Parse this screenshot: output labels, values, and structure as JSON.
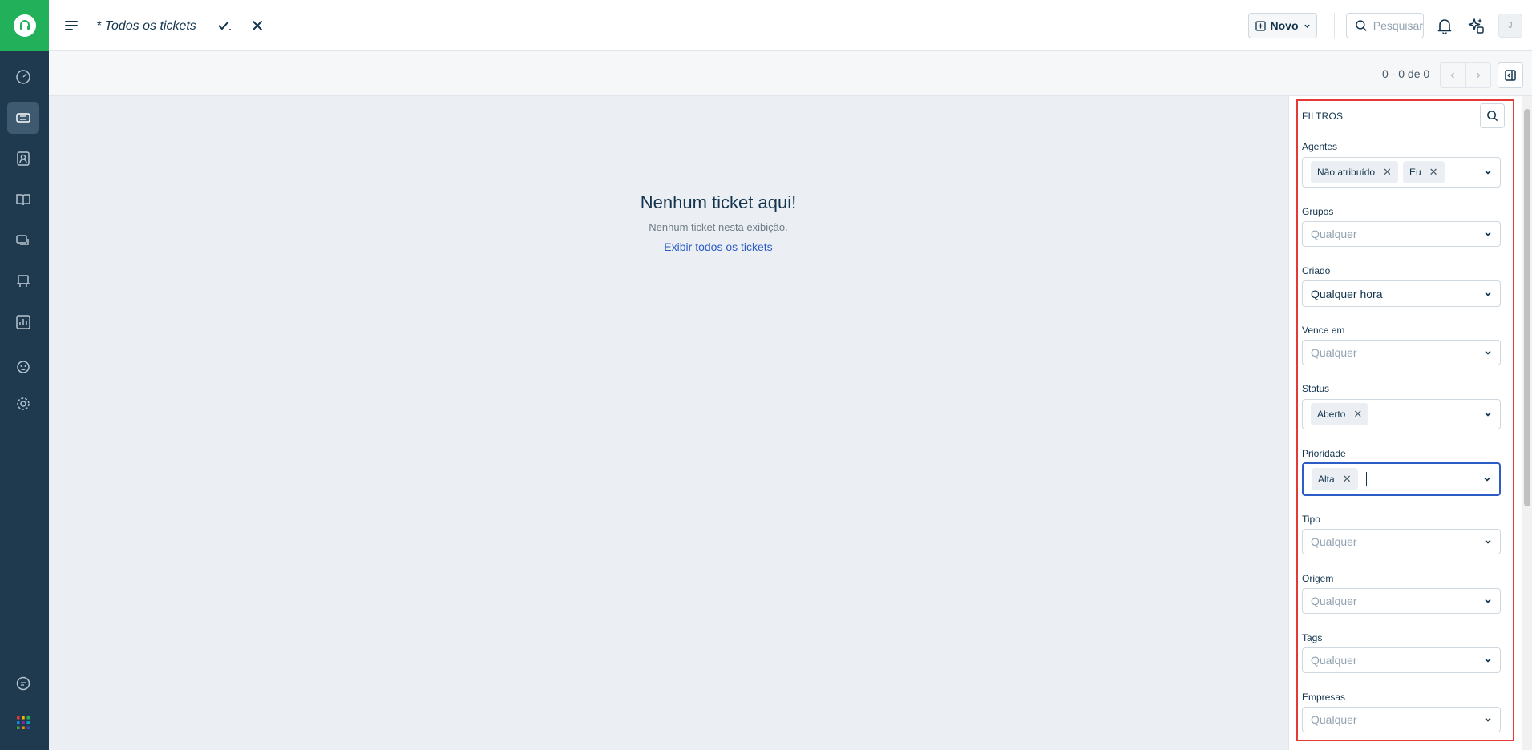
{
  "header": {
    "view_title": "* Todos os tickets",
    "new_button_label": "Novo",
    "search_placeholder": "Pesquisar",
    "avatar_initial": "J"
  },
  "subbar": {
    "pagination": "0 - 0 de 0"
  },
  "empty_state": {
    "title": "Nenhum ticket aqui!",
    "subtitle": "Nenhum ticket nesta exibição.",
    "link": "Exibir todos os tickets"
  },
  "filters": {
    "title": "FILTROS",
    "agentes": {
      "label": "Agentes",
      "chips": [
        "Não atribuído",
        "Eu"
      ]
    },
    "grupos": {
      "label": "Grupos",
      "placeholder": "Qualquer"
    },
    "criado": {
      "label": "Criado",
      "value": "Qualquer hora"
    },
    "vence_em": {
      "label": "Vence em",
      "placeholder": "Qualquer"
    },
    "status": {
      "label": "Status",
      "chips": [
        "Aberto"
      ]
    },
    "prioridade": {
      "label": "Prioridade",
      "chips": [
        "Alta"
      ]
    },
    "tipo": {
      "label": "Tipo",
      "placeholder": "Qualquer"
    },
    "origem": {
      "label": "Origem",
      "placeholder": "Qualquer"
    },
    "tags": {
      "label": "Tags",
      "placeholder": "Qualquer"
    },
    "empresas": {
      "label": "Empresas",
      "placeholder": "Qualquer"
    }
  },
  "colors": {
    "brand_green": "#22b05b",
    "rail_bg": "#1f3a4f",
    "link_blue": "#2c5cc5",
    "highlight_red": "#e53935"
  },
  "icons": {
    "rail": [
      "dashboard-icon",
      "tickets-icon",
      "contacts-icon",
      "solutions-icon",
      "forums-icon",
      "assets-icon",
      "reports-icon",
      "bot-icon",
      "admin-icon",
      "chat-icon",
      "apps-icon"
    ]
  }
}
